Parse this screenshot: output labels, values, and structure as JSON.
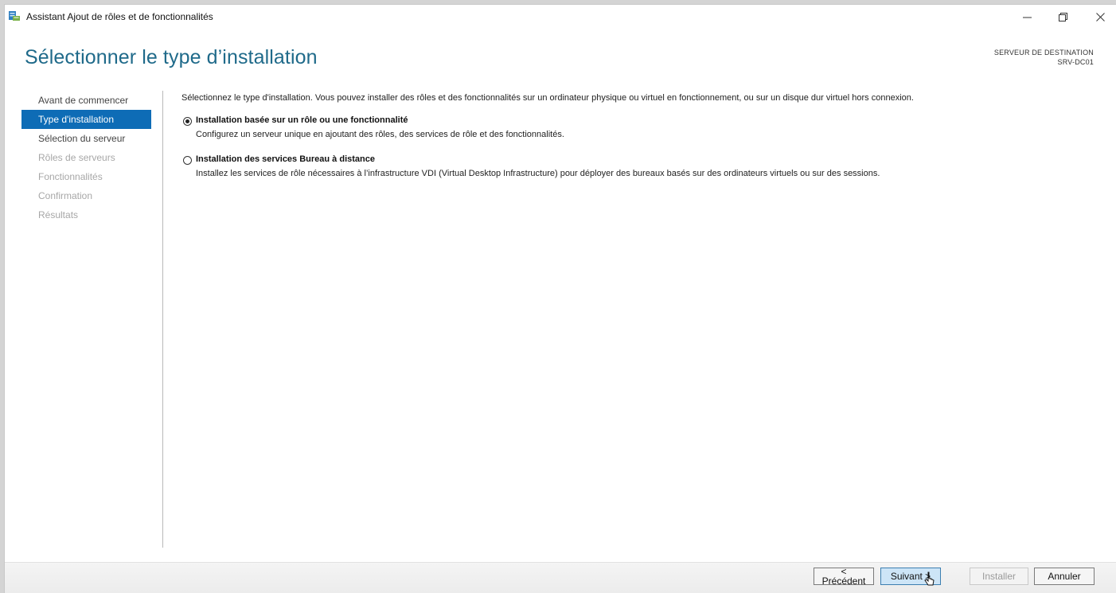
{
  "window": {
    "title": "Assistant Ajout de rôles et de fonctionnalités",
    "controls": [
      "minimize-icon",
      "restore-icon",
      "close-icon"
    ]
  },
  "header": {
    "page_title": "Sélectionner le type d’installation",
    "destination_label": "SERVEUR DE DESTINATION",
    "destination_server": "SRV-DC01"
  },
  "sidebar": {
    "items": [
      {
        "label": "Avant de commencer",
        "state": "normal"
      },
      {
        "label": "Type d'installation",
        "state": "active"
      },
      {
        "label": "Sélection du serveur",
        "state": "normal"
      },
      {
        "label": "Rôles de serveurs",
        "state": "disabled"
      },
      {
        "label": "Fonctionnalités",
        "state": "disabled"
      },
      {
        "label": "Confirmation",
        "state": "disabled"
      },
      {
        "label": "Résultats",
        "state": "disabled"
      }
    ]
  },
  "main": {
    "intro": "Sélectionnez le type d'installation. Vous pouvez installer des rôles et des fonctionnalités sur un ordinateur physique ou virtuel en fonctionnement, ou sur un disque dur virtuel hors connexion.",
    "options": [
      {
        "title": "Installation basée sur un rôle ou une fonctionnalité",
        "description": "Configurez un serveur unique en ajoutant des rôles, des services de rôle et des fonctionnalités.",
        "selected": true
      },
      {
        "title": "Installation des services Bureau à distance",
        "description": "Installez les services de rôle nécessaires à l’infrastructure VDI (Virtual Desktop Infrastructure) pour déployer des bureaux basés sur des ordinateurs virtuels ou sur des sessions.",
        "selected": false
      }
    ]
  },
  "footer": {
    "previous_label": "< Précédent",
    "next_label": "Suivant >",
    "install_label": "Installer",
    "cancel_label": "Annuler"
  },
  "colors": {
    "accent": "#0e6cb6",
    "title": "#1f6a8a",
    "disabled_text": "#a7a7a7"
  }
}
